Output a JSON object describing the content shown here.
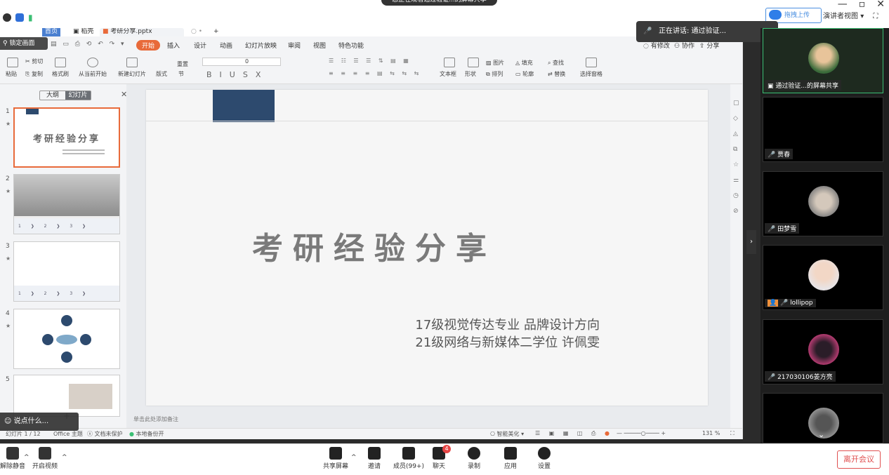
{
  "meeting": {
    "banner": "您正在观看通过验证...的屏幕共享",
    "speaking": "正在讲话: 通过验证...",
    "upload_button": "拖拽上传",
    "view_select": "演讲者视图",
    "leave_button": "离开会议",
    "toolbar": [
      {
        "label": "解除静音"
      },
      {
        "label": "开启视频"
      },
      {
        "label": "共享屏幕"
      },
      {
        "label": "邀请"
      },
      {
        "label": "成员(99+)"
      },
      {
        "label": "聊天"
      },
      {
        "label": "录制"
      },
      {
        "label": "应用"
      },
      {
        "label": "设置"
      }
    ],
    "chat_badge": "4",
    "chat_input_placeholder": "说点什么..."
  },
  "participants": [
    {
      "name": "通过验证...的屏幕共享",
      "highlight": true
    },
    {
      "name": "贾春",
      "highlight": false
    },
    {
      "name": "田梦雪",
      "highlight": false
    },
    {
      "name": "lollipop",
      "highlight": false
    },
    {
      "name": "217030106姜方亮",
      "highlight": false
    },
    {
      "name": "",
      "highlight": false
    }
  ],
  "wps": {
    "tabs": {
      "home": "首页",
      "docer": "稻壳",
      "file": "考研分享.pptx"
    },
    "lock_screen": "锁定画面",
    "menu": [
      "开始",
      "插入",
      "设计",
      "动画",
      "幻灯片放映",
      "审阅",
      "视图",
      "特色功能"
    ],
    "menu_right": [
      "有修改",
      "协作",
      "分享"
    ],
    "ribbon": {
      "paste": "粘贴",
      "cut": "剪切",
      "copy": "复制",
      "format_painter": "格式刷",
      "from_current": "从当前开始",
      "new_slide": "新建幻灯片",
      "layout": "版式",
      "section": "节",
      "reset": "重置",
      "font_size": "0",
      "textbox": "文本框",
      "shape": "形状",
      "picture": "图片",
      "fill": "填充",
      "arrange": "排列",
      "outline": "轮廓",
      "find": "查找",
      "replace": "替换",
      "select_pane": "选择窗格"
    },
    "pane_tabs": {
      "outline": "大纲",
      "slides": "幻灯片"
    },
    "thumbnails": [
      {
        "num": "1",
        "title": "考研经验分享"
      },
      {
        "num": "2"
      },
      {
        "num": "3"
      },
      {
        "num": "4"
      },
      {
        "num": "5"
      }
    ],
    "slide": {
      "title": "考研经验分享",
      "subtitle_1": "17级视觉传达专业 品牌设计方向",
      "subtitle_2": "21级网络与新媒体二学位  许佩雯"
    },
    "notes_placeholder": "单击此处添加备注",
    "status": {
      "slide_count": "幻灯片 1 / 12",
      "theme": "Office 主题",
      "protection": "文档未保护",
      "backup": "本地备份开",
      "beautify": "智能美化",
      "zoom": "131 %"
    }
  }
}
